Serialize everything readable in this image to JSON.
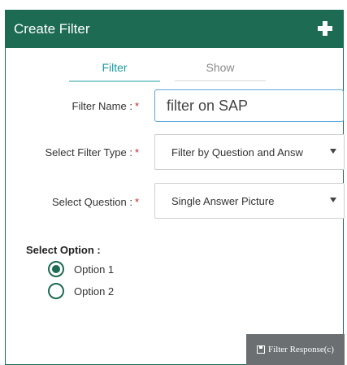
{
  "header": {
    "title": "Create Filter",
    "add_icon": "plus-icon"
  },
  "tabs": [
    {
      "label": "Filter",
      "active": true
    },
    {
      "label": "Show",
      "active": false
    }
  ],
  "form": {
    "filter_name": {
      "label": "Filter Name :",
      "required": "*",
      "value": "filter on SAP"
    },
    "filter_type": {
      "label": "Select Filter Type :",
      "required": "*",
      "value": "Filter by Question and Answ"
    },
    "question": {
      "label": "Select Question :",
      "required": "*",
      "value": "Single Answer Picture"
    }
  },
  "options": {
    "label": "Select Option :",
    "items": [
      {
        "label": "Option 1",
        "selected": true
      },
      {
        "label": "Option 2",
        "selected": false
      }
    ]
  },
  "footer": {
    "button_label": "Filter Response(c)",
    "button_icon": "save-icon"
  },
  "colors": {
    "primary": "#1c6b52",
    "tab_active": "#1c9aa0",
    "required": "#c62828",
    "button": "#6b6f72"
  }
}
